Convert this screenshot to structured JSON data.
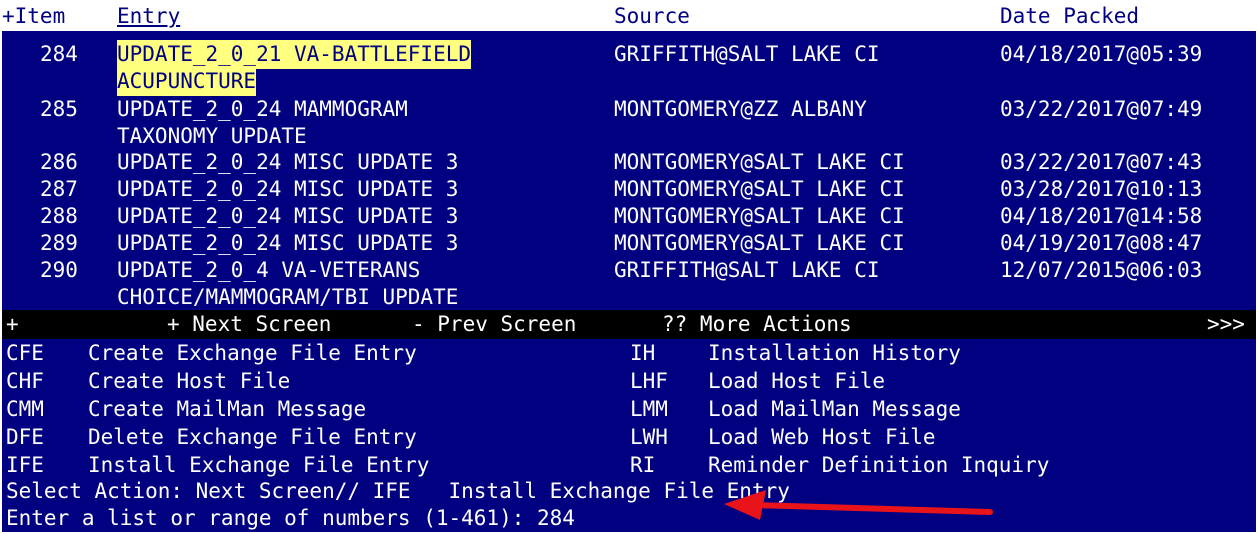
{
  "header": {
    "item": "+Item",
    "entry": "Entry",
    "source": "Source",
    "date": "Date Packed"
  },
  "items": [
    {
      "num": "284",
      "entry1": "UPDATE_2_0_21 VA-BATTLEFIELD",
      "entry2": "ACUPUNCTURE",
      "source": "GRIFFITH@SALT LAKE CI",
      "date": "04/18/2017@05:39"
    },
    {
      "num": "285",
      "entry1": "UPDATE_2_0_24 MAMMOGRAM",
      "entry2": "TAXONOMY UPDATE",
      "source": "MONTGOMERY@ZZ ALBANY",
      "date": "03/22/2017@07:49"
    },
    {
      "num": "286",
      "entry1": "UPDATE_2_0_24 MISC UPDATE 3",
      "source": "MONTGOMERY@SALT LAKE CI",
      "date": "03/22/2017@07:43"
    },
    {
      "num": "287",
      "entry1": "UPDATE_2_0_24 MISC UPDATE 3",
      "source": "MONTGOMERY@SALT LAKE CI",
      "date": "03/28/2017@10:13"
    },
    {
      "num": "288",
      "entry1": "UPDATE_2_0_24 MISC UPDATE 3",
      "source": "MONTGOMERY@SALT LAKE CI",
      "date": "04/18/2017@14:58"
    },
    {
      "num": "289",
      "entry1": "UPDATE_2_0_24 MISC UPDATE 3",
      "source": "MONTGOMERY@SALT LAKE CI",
      "date": "04/19/2017@08:47"
    },
    {
      "num": "290",
      "entry1": "UPDATE_2_0_4 VA-VETERANS",
      "entry2": "CHOICE/MAMMOGRAM/TBI UPDATE",
      "source": "GRIFFITH@SALT LAKE CI",
      "date": "12/07/2015@06:03"
    }
  ],
  "nav": {
    "plus": "+",
    "next": "+ Next Screen",
    "prev": "- Prev Screen",
    "more": "?? More Actions",
    "scroll": ">>>"
  },
  "actions": [
    {
      "code": "CFE",
      "label": "Create Exchange File Entry",
      "code2": "IH",
      "label2": "Installation History"
    },
    {
      "code": "CHF",
      "label": "Create Host File",
      "code2": "LHF",
      "label2": "Load Host File"
    },
    {
      "code": "CMM",
      "label": "Create MailMan Message",
      "code2": "LMM",
      "label2": "Load MailMan Message"
    },
    {
      "code": "DFE",
      "label": "Delete Exchange File Entry",
      "code2": "LWH",
      "label2": "Load Web Host File"
    },
    {
      "code": "IFE",
      "label": "Install Exchange File Entry",
      "code2": "RI",
      "label2": "Reminder Definition Inquiry"
    }
  ],
  "prompt": {
    "select": "Select Action: Next Screen// IFE   Install Exchange File Entry",
    "range": "Enter a list or range of numbers (1-461): 284"
  },
  "annotation": {
    "arrow_color": "#e8141a"
  }
}
